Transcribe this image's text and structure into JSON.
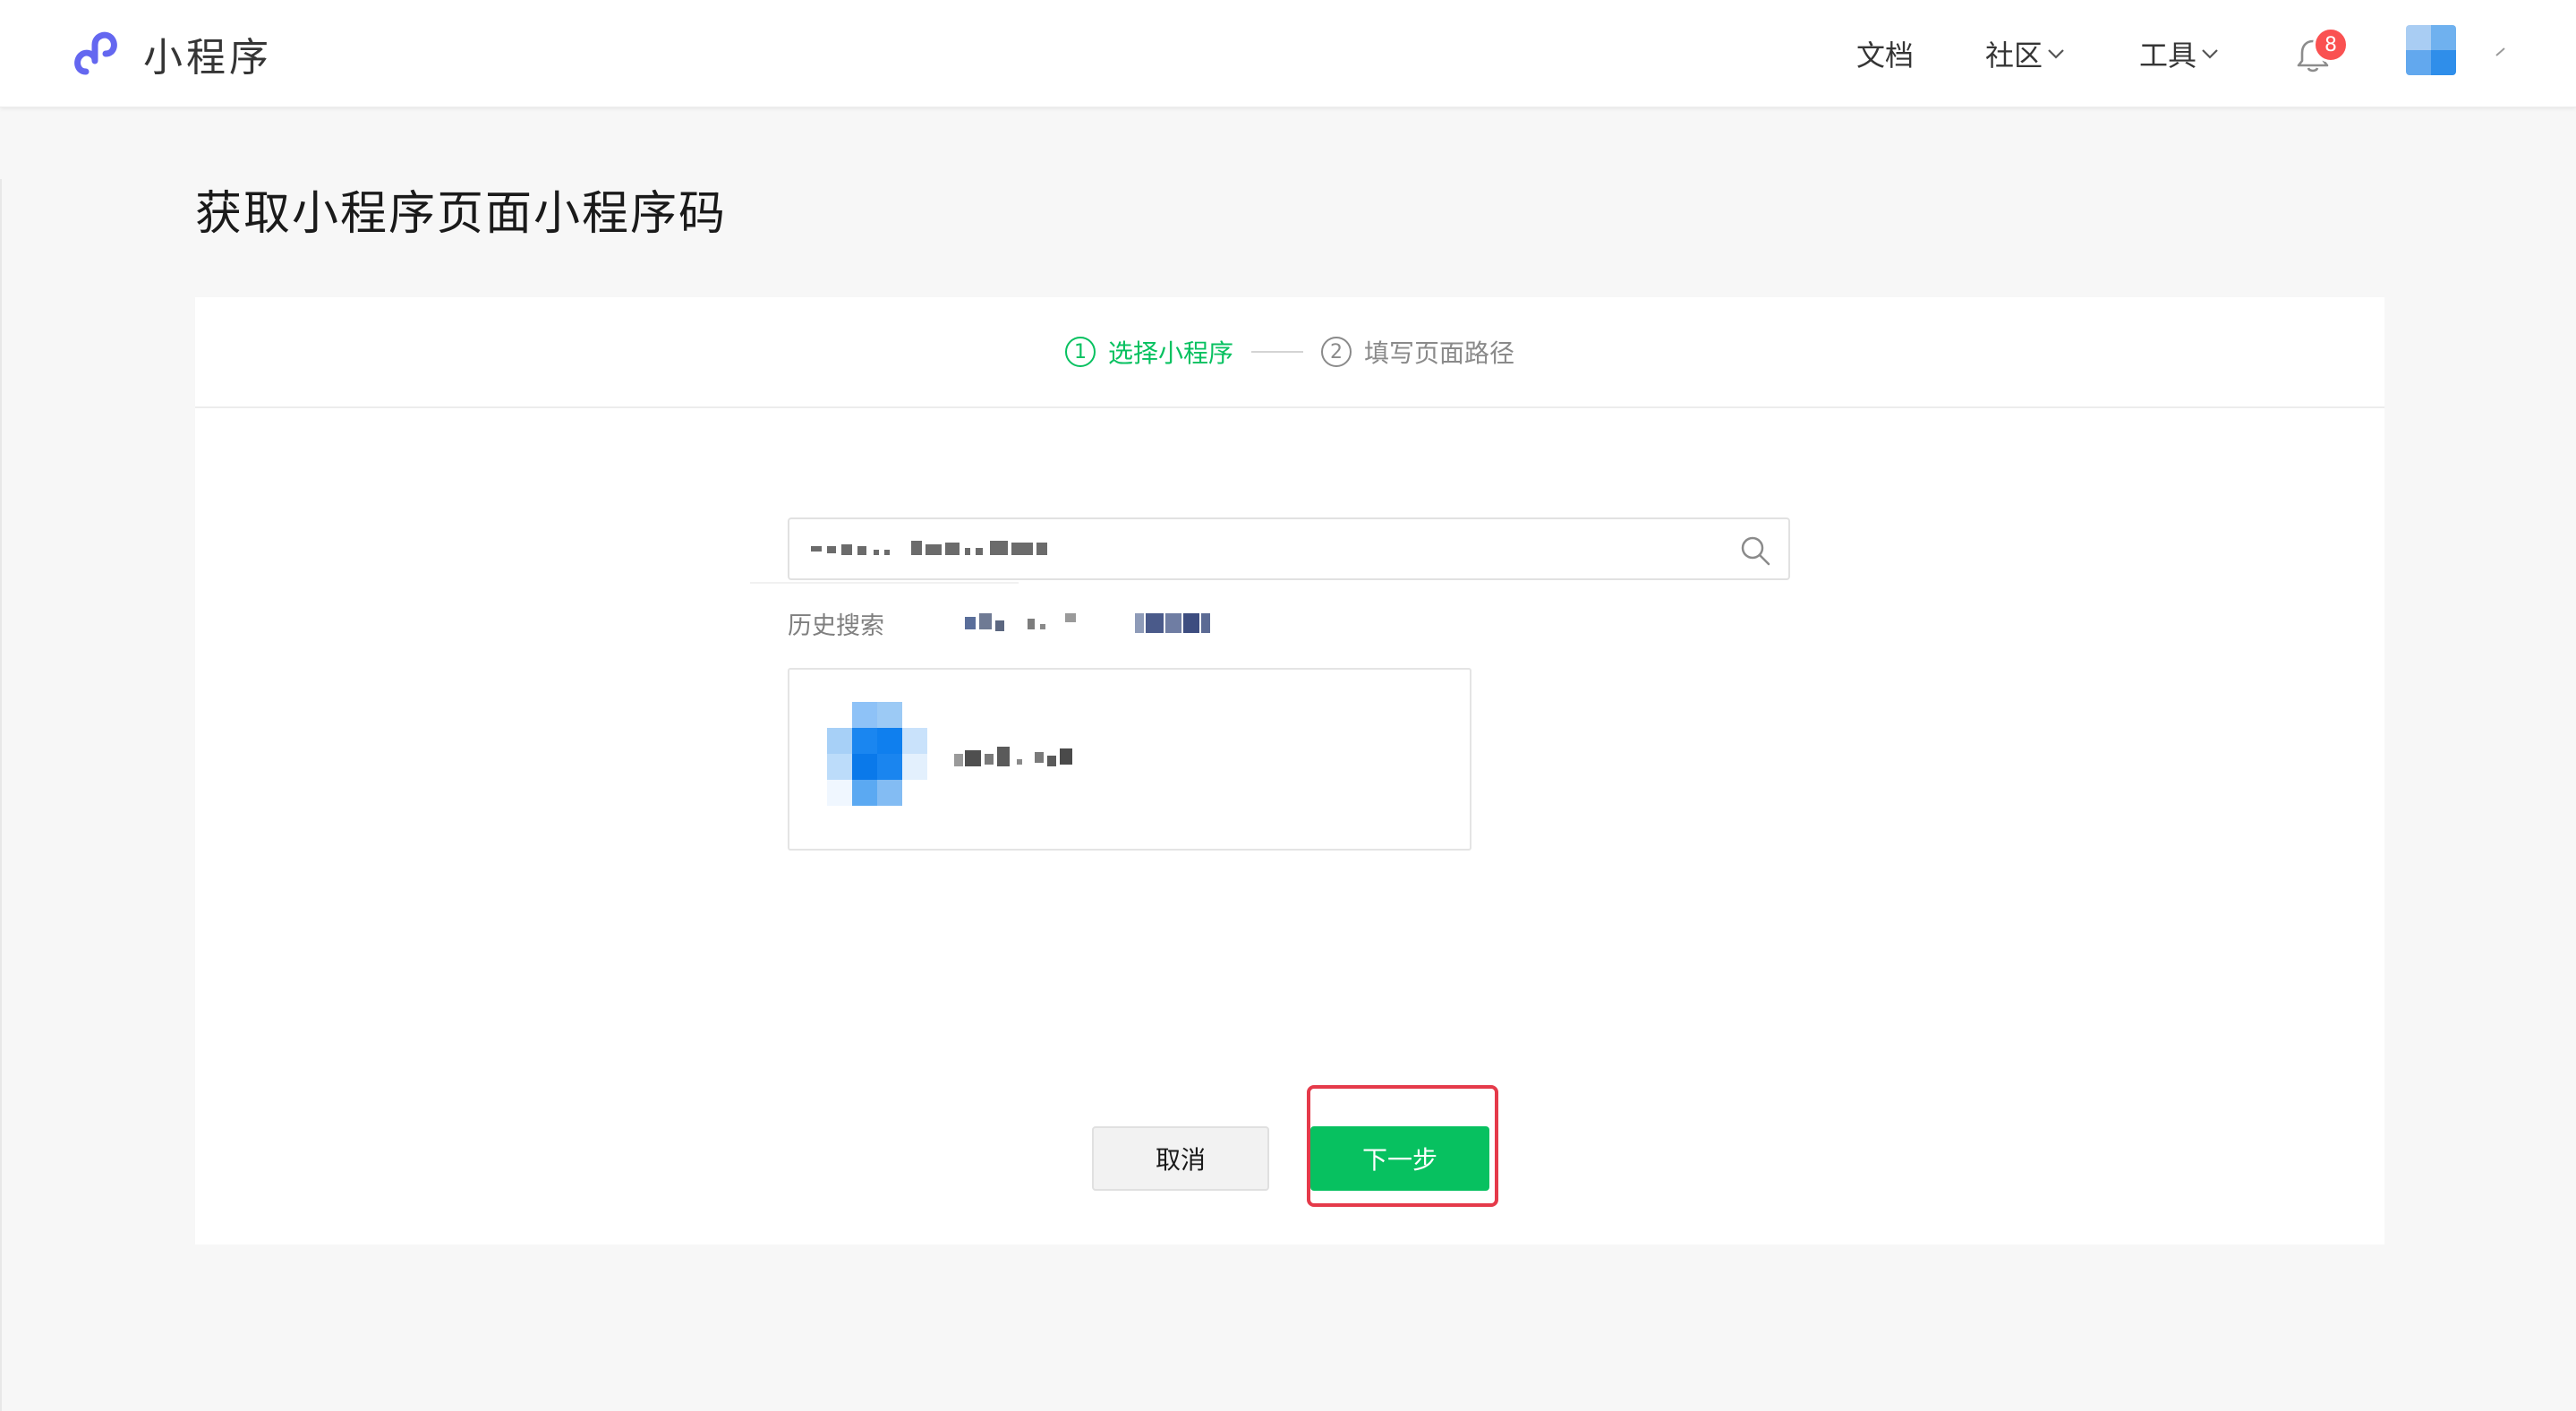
{
  "app": {
    "logo_text": "小程序",
    "brand_color": "#6467f0"
  },
  "nav": {
    "docs": "文档",
    "community": "社区",
    "tools": "工具",
    "notification_count": "8"
  },
  "page": {
    "title": "获取小程序页面小程序码"
  },
  "steps": [
    {
      "num": "1",
      "label": "选择小程序",
      "state": "active"
    },
    {
      "num": "2",
      "label": "填写页面路径",
      "state": "pending"
    }
  ],
  "search": {
    "value_redacted": true,
    "icon": "search-icon"
  },
  "history": {
    "label": "历史搜索"
  },
  "buttons": {
    "cancel": "取消",
    "next": "下一步"
  },
  "colors": {
    "primary_green": "#07c160",
    "badge_red": "#fa5151",
    "highlight_red": "#e53a4a"
  }
}
